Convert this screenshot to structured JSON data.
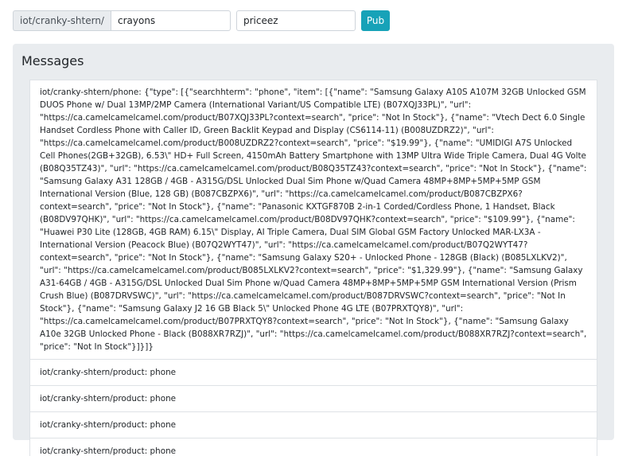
{
  "publish": {
    "topic_prefix": "iot/cranky-shtern/",
    "topic_value": "crayons",
    "payload_value": "priceez",
    "pub_label": "Pub"
  },
  "messages": {
    "title": "Messages",
    "items": [
      "iot/cranky-shtern/phone: {\"type\": [{\"searchhterm\": \"phone\", \"item\": [{\"name\": \"Samsung Galaxy A10S A107M 32GB Unlocked GSM DUOS Phone w/ Dual 13MP/2MP Camera (International Variant/US Compatible LTE) (B07XQJ33PL)\", \"url\": \"https://ca.camelcamelcamel.com/product/B07XQJ33PL?context=search\", \"price\": \"Not In Stock\"}, {\"name\": \"Vtech Dect 6.0 Single Handset Cordless Phone with Caller ID, Green Backlit Keypad and Display (CS6114-11) (B008UZDRZ2)\", \"url\": \"https://ca.camelcamelcamel.com/product/B008UZDRZ2?context=search\", \"price\": \"$19.99\"}, {\"name\": \"UMIDIGI A7S Unlocked Cell Phones(2GB+32GB), 6.53\\\" HD+ Full Screen, 4150mAh Battery Smartphone with 13MP Ultra Wide Triple Camera, Dual 4G Volte (B08Q35TZ43)\", \"url\": \"https://ca.camelcamelcamel.com/product/B08Q35TZ43?context=search\", \"price\": \"Not In Stock\"}, {\"name\": \"Samsung Galaxy A31 128GB / 4GB - A315G/DSL Unlocked Dual Sim Phone w/Quad Camera 48MP+8MP+5MP+5MP GSM International Version (Blue, 128 GB) (B087CBZPX6)\", \"url\": \"https://ca.camelcamelcamel.com/product/B087CBZPX6?context=search\", \"price\": \"Not In Stock\"}, {\"name\": \"Panasonic KXTGF870B 2-in-1 Corded/Cordless Phone, 1 Handset, Black (B08DV97QHK)\", \"url\": \"https://ca.camelcamelcamel.com/product/B08DV97QHK?context=search\", \"price\": \"$109.99\"}, {\"name\": \"Huawei P30 Lite (128GB, 4GB RAM) 6.15\\\" Display, AI Triple Camera, Dual SIM Global GSM Factory Unlocked MAR-LX3A - International Version (Peacock Blue) (B07Q2WYT47)\", \"url\": \"https://ca.camelcamelcamel.com/product/B07Q2WYT47?context=search\", \"price\": \"Not In Stock\"}, {\"name\": \"Samsung Galaxy S20+ - Unlocked Phone - 128GB (Black) (B085LXLKV2)\", \"url\": \"https://ca.camelcamelcamel.com/product/B085LXLKV2?context=search\", \"price\": \"$1,329.99\"}, {\"name\": \"Samsung Galaxy A31-64GB / 4GB - A315G/DSL Unlocked Dual Sim Phone w/Quad Camera 48MP+8MP+5MP+5MP GSM International Version (Prism Crush Blue) (B087DRVSWC)\", \"url\": \"https://ca.camelcamelcamel.com/product/B087DRVSWC?context=search\", \"price\": \"Not In Stock\"}, {\"name\": \"Samsung Galaxy J2 16 GB Black 5\\\" Unlocked Phone 4G LTE (B07PRXTQY8)\", \"url\": \"https://ca.camelcamelcamel.com/product/B07PRXTQY8?context=search\", \"price\": \"Not In Stock\"}, {\"name\": \"Samsung Galaxy A10e 32GB Unlocked Phone - Black (B088XR7RZJ)\", \"url\": \"https://ca.camelcamelcamel.com/product/B088XR7RZJ?context=search\", \"price\": \"Not In Stock\"}]}]}",
      "iot/cranky-shtern/product: phone",
      "iot/cranky-shtern/product: phone",
      "iot/cranky-shtern/product: phone",
      "iot/cranky-shtern/product: phone"
    ]
  }
}
